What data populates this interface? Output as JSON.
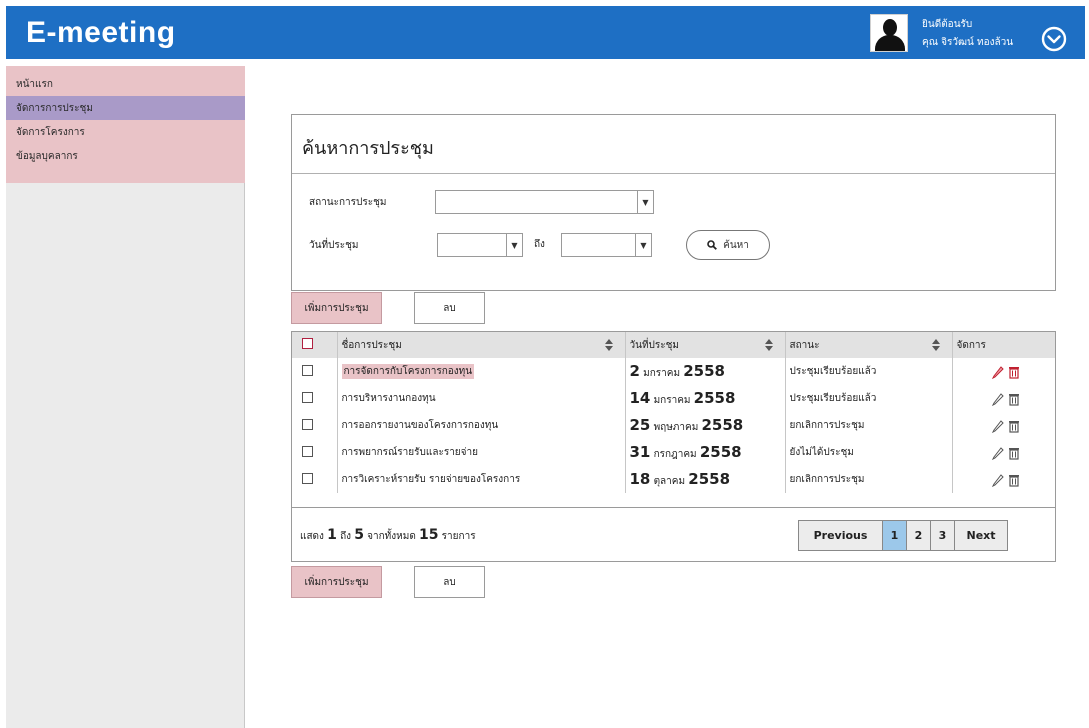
{
  "app": {
    "title": "E-meeting"
  },
  "user": {
    "welcome": "ยินดีต้อนรับ",
    "name": "คุณ จิรวัฒน์ ทองล้วน",
    "menu_icon": "chevron-down-circle-icon"
  },
  "sidebar": {
    "items": [
      {
        "label": "หน้าแรก",
        "active": false
      },
      {
        "label": "จัดการการประชุม",
        "active": true
      },
      {
        "label": "จัดการโครงการ",
        "active": false
      },
      {
        "label": "ข้อมูลบุคลากร",
        "active": false
      }
    ]
  },
  "search": {
    "title": "ค้นหาการประชุม",
    "status_label": "สถานะการประชุม",
    "status_value": "",
    "date_label": "วันที่ประชุม",
    "date_from": "",
    "to_label": "ถึง",
    "date_to": "",
    "button_label": "ค้นหา"
  },
  "actions": {
    "add_label": "เพิ่มการประชุม",
    "delete_label": "ลบ"
  },
  "table": {
    "columns": {
      "name": "ชื่อการประชุม",
      "date": "วันที่ประชุม",
      "status": "สถานะ",
      "manage": "จัดการ"
    },
    "rows": [
      {
        "name": "การจัดการกับโครงการกองทุน",
        "day": "2",
        "month": "มกราคม",
        "year": "2558",
        "status": "ประชุมเรียบร้อยแล้ว",
        "highlight": true
      },
      {
        "name": "การบริหารงานกองทุน",
        "day": "14",
        "month": "มกราคม",
        "year": "2558",
        "status": "ประชุมเรียบร้อยแล้ว",
        "highlight": false
      },
      {
        "name": "การออกรายงานของโครงการกองทุน",
        "day": "25",
        "month": "พฤษภาคม",
        "year": "2558",
        "status": "ยกเลิกการประชุม",
        "highlight": false
      },
      {
        "name": "การพยากรณ์รายรับและรายจ่าย",
        "day": "31",
        "month": "กรกฎาคม",
        "year": "2558",
        "status": "ยังไม่ได้ประชุม",
        "highlight": false
      },
      {
        "name": "การวิเคราะห์รายรับ รายจ่ายของโครงการ",
        "day": "18",
        "month": "ตุลาคม",
        "year": "2558",
        "status": "ยกเลิกการประชุม",
        "highlight": false
      }
    ]
  },
  "footer": {
    "show_label": "แสดง",
    "from": "1",
    "to_label": "ถึง",
    "to": "5",
    "total_label": "จากทั้งหมด",
    "total": "15",
    "unit_label": "รายการ"
  },
  "pagination": {
    "previous": "Previous",
    "pages": [
      "1",
      "2",
      "3"
    ],
    "current": "1",
    "next": "Next"
  },
  "colors": {
    "header": "#1e6fc4",
    "pink": "#e9c3c7",
    "active_menu": "#a99ac8",
    "active_page": "#9cc8ea"
  }
}
